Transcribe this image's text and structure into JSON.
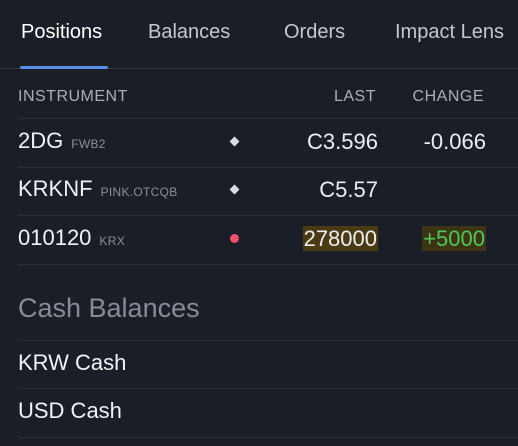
{
  "tabs": [
    {
      "label": "Positions",
      "active": true
    },
    {
      "label": "Balances",
      "active": false
    },
    {
      "label": "Orders",
      "active": false
    },
    {
      "label": "Impact Lens",
      "active": false
    }
  ],
  "table": {
    "headers": {
      "instrument": "INSTRUMENT",
      "last": "LAST",
      "change": "CHANGE"
    },
    "rows": [
      {
        "symbol": "2DG",
        "exchange": "FWB2",
        "indicator": "diamond-icon",
        "last": "C3.596",
        "change": "-0.066"
      },
      {
        "symbol": "KRKNF",
        "exchange": "PINK.OTCQB",
        "indicator": "diamond-icon",
        "last": "C5.57",
        "change": ""
      },
      {
        "symbol": "010120",
        "exchange": "KRX",
        "indicator": "red-dot-icon",
        "last": "278000",
        "change": "+5000"
      }
    ]
  },
  "cash": {
    "title": "Cash Balances",
    "items": [
      {
        "label": "KRW Cash"
      },
      {
        "label": "USD Cash"
      }
    ]
  },
  "colors": {
    "background": "#1a1e26",
    "accent": "#5b8ee6",
    "positive": "#4cc85a",
    "alert_dot": "#f0506b",
    "highlight": "#4a3b14"
  }
}
